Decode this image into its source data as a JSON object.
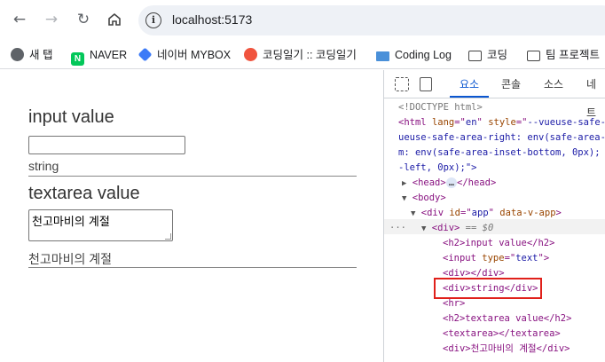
{
  "browser": {
    "url": "localhost:5173",
    "bookmarks": [
      {
        "label": "새 탭",
        "icon": "globe-icon"
      },
      {
        "label": "NAVER",
        "icon": "naver-icon"
      },
      {
        "label": "네이버 MYBOX",
        "icon": "mybox-icon"
      },
      {
        "label": "코딩일기 :: 코딩일기",
        "icon": "tistory-icon"
      },
      {
        "label": "Coding Log",
        "icon": "monitor-icon"
      },
      {
        "label": "코딩",
        "icon": "folder-icon"
      },
      {
        "label": "팀 프로젝트",
        "icon": "folder-icon"
      }
    ]
  },
  "page": {
    "input_heading": "input value",
    "input_value": "",
    "input_echo": "string",
    "textarea_heading": "textarea value",
    "textarea_value": "천고마비의 계절",
    "textarea_echo": "천고마비의 계절"
  },
  "devtools": {
    "tabs": [
      "요소",
      "콘솔",
      "소스",
      "네트"
    ],
    "active_tab": "요소",
    "lines": {
      "l1": "<!DOCTYPE html>",
      "l2a": "<html ",
      "l2b": "lang",
      "l2c": "=\"",
      "l2d": "en",
      "l2e": "\" ",
      "l2f": "style",
      "l2g": "=\"",
      "l2h": "--vueuse-safe-area",
      "l3": "ueuse-safe-area-right: env(safe-area-in",
      "l4": "m: env(safe-area-inset-bottom, 0px); --",
      "l5": "-left, 0px);\">",
      "l6": "<head>",
      "l6b": "…",
      "l6c": "</head>",
      "l7": "<body>",
      "l8a": "<div ",
      "l8b": "id",
      "l8c": "=\"",
      "l8d": "app",
      "l8e": "\" ",
      "l8f": "data-v-app",
      "l8g": ">",
      "l9a": "<div>",
      "l9b": " == $0",
      "l10": "<h2>input value</h2>",
      "l11a": "<input ",
      "l11b": "type",
      "l11c": "=\"",
      "l11d": "text",
      "l11e": "\">",
      "l12": "<div></div>",
      "l13": "<div>string</div>",
      "l14": "<hr>",
      "l15": "<h2>textarea value</h2>",
      "l16": "<textarea></textarea>",
      "l17": "<div>천고마비의 계절</div>"
    }
  }
}
